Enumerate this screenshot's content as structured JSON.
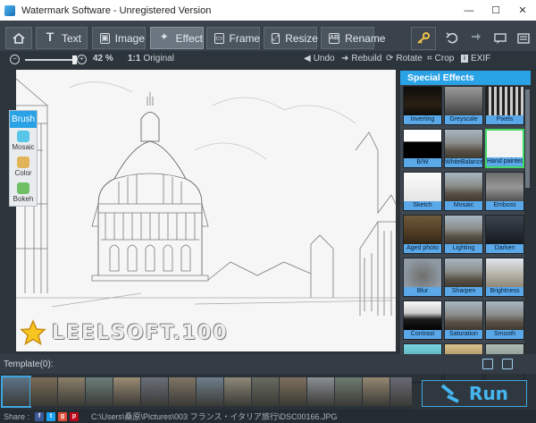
{
  "window": {
    "title": "Watermark Software - Unregistered Version",
    "minimize": "—",
    "maximize": "☐",
    "close": "✕"
  },
  "tabs": [
    {
      "label": "Text",
      "icon": "T"
    },
    {
      "label": "Image",
      "icon": "▣"
    },
    {
      "label": "Effect",
      "icon": "✦",
      "active": true
    },
    {
      "label": "Frame",
      "icon": "▭"
    },
    {
      "label": "Resize",
      "icon": "⤢"
    },
    {
      "label": "Rename",
      "icon": "AB"
    }
  ],
  "toolbar": {
    "zoom": "42 %",
    "zoom_level_percent": 42,
    "original_label": "Original",
    "original_icon": "1:1",
    "undo": "Undo",
    "rebuild": "Rebuild",
    "rotate": "Rotate",
    "crop": "Crop",
    "exif": "EXIF"
  },
  "brush": {
    "header": "Brush",
    "items": [
      {
        "label": "Mosaic",
        "color": "#57c6e8"
      },
      {
        "label": "Color",
        "color": "#e2b45a"
      },
      {
        "label": "Bokeh",
        "color": "#6fbf65"
      }
    ]
  },
  "watermark": {
    "text": "LEELSOFT.100"
  },
  "effects": {
    "header": "Special Effects",
    "items": [
      {
        "label": "Inverting",
        "style": "dark"
      },
      {
        "label": "Greyscale",
        "style": "grey"
      },
      {
        "label": "Pixels",
        "style": "pixels"
      },
      {
        "label": "B/W",
        "style": "bw"
      },
      {
        "label": "WhiteBalance",
        "style": "photo"
      },
      {
        "label": "Hand painted",
        "style": "sketchlight",
        "selected": true
      },
      {
        "label": "Sketch",
        "style": "sketch"
      },
      {
        "label": "Mosaic",
        "style": "photo"
      },
      {
        "label": "Emboss",
        "style": "emboss"
      },
      {
        "label": "Aged photo",
        "style": "aged"
      },
      {
        "label": "Lighting",
        "style": "photo"
      },
      {
        "label": "Darken",
        "style": "darken"
      },
      {
        "label": "Blur",
        "style": "blur"
      },
      {
        "label": "Sharpen",
        "style": "photo"
      },
      {
        "label": "Brightness",
        "style": "bright"
      },
      {
        "label": "Contrast",
        "style": "contrast"
      },
      {
        "label": "Saturation",
        "style": "photo"
      },
      {
        "label": "Smooth",
        "style": "photo"
      },
      {
        "label": "",
        "style": "cyan"
      },
      {
        "label": "",
        "style": "warm"
      },
      {
        "label": "",
        "style": "teal"
      }
    ]
  },
  "templates": {
    "label": "Template(0):"
  },
  "run": {
    "label": "Run"
  },
  "status": {
    "share_label": "Share :",
    "path": "C:\\Users\\桑原\\Pictures\\003 フランス・イタリア旅行\\DSC00166.JPG"
  }
}
